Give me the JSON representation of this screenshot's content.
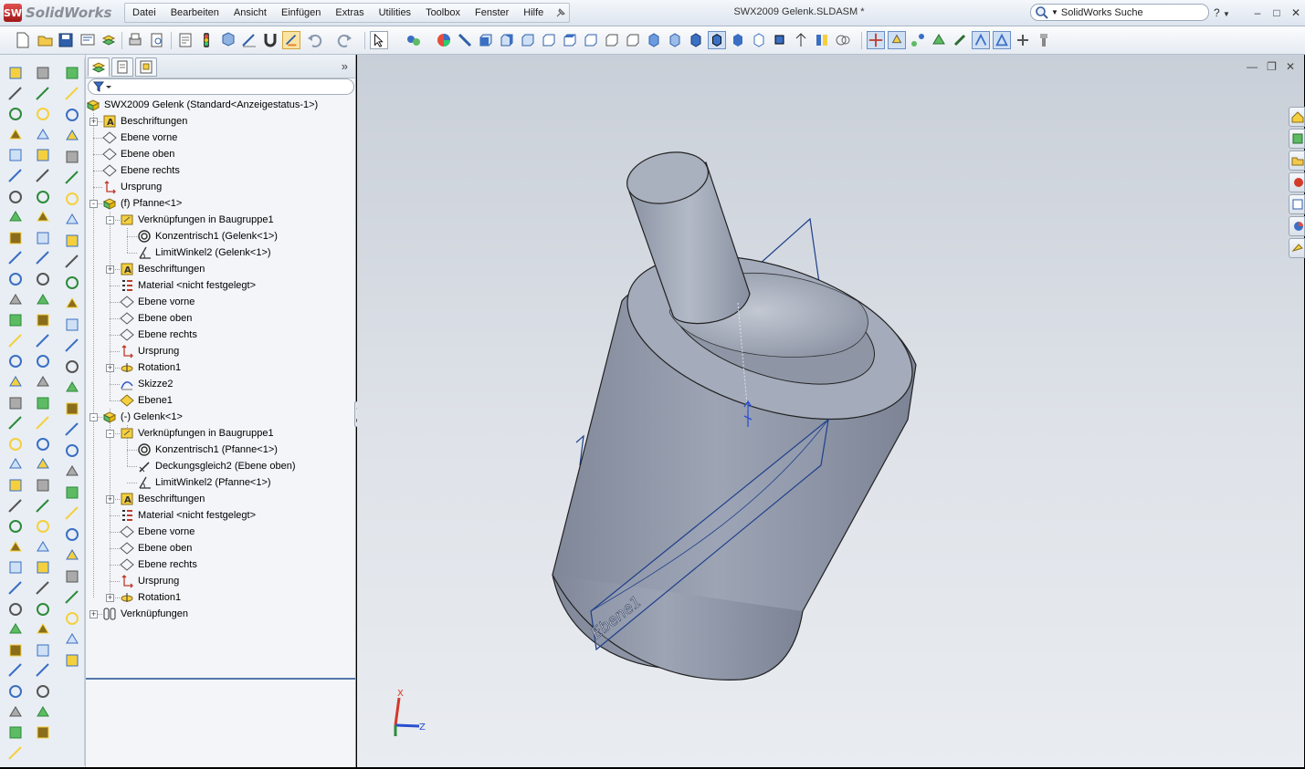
{
  "app": {
    "logo_text": "SolidWorks",
    "document_title": "SWX2009 Gelenk.SLDASM *",
    "search_placeholder": "SolidWorks Suche",
    "help_label": "?",
    "menus": [
      "Datei",
      "Bearbeiten",
      "Ansicht",
      "Einfügen",
      "Extras",
      "Utilities",
      "Toolbox",
      "Fenster",
      "Hilfe"
    ]
  },
  "feature_tree": {
    "root": "SWX2009 Gelenk  (Standard<Anzeigestatus-1>)",
    "items": [
      {
        "label": "Beschriftungen",
        "icon": "annotations-icon",
        "level": 0,
        "expander": "+"
      },
      {
        "label": "Ebene vorne",
        "icon": "plane-icon",
        "level": 0
      },
      {
        "label": "Ebene oben",
        "icon": "plane-icon",
        "level": 0
      },
      {
        "label": "Ebene rechts",
        "icon": "plane-icon",
        "level": 0
      },
      {
        "label": "Ursprung",
        "icon": "origin-icon",
        "level": 0
      },
      {
        "label": "(f) Pfanne<1>",
        "icon": "part-icon",
        "level": 0,
        "expander": "-"
      },
      {
        "label": "Verknüpfungen in Baugruppe1",
        "icon": "mates-folder-icon",
        "level": 1,
        "expander": "-"
      },
      {
        "label": "Konzentrisch1 (Gelenk<1>)",
        "icon": "concentric-mate-icon",
        "level": 2
      },
      {
        "label": "LimitWinkel2 (Gelenk<1>)",
        "icon": "limit-angle-mate-icon",
        "level": 2
      },
      {
        "label": "Beschriftungen",
        "icon": "annotations-icon",
        "level": 1,
        "expander": "+"
      },
      {
        "label": "Material <nicht festgelegt>",
        "icon": "material-icon",
        "level": 1
      },
      {
        "label": "Ebene vorne",
        "icon": "plane-icon",
        "level": 1
      },
      {
        "label": "Ebene oben",
        "icon": "plane-icon",
        "level": 1
      },
      {
        "label": "Ebene rechts",
        "icon": "plane-icon",
        "level": 1
      },
      {
        "label": "Ursprung",
        "icon": "origin-icon",
        "level": 1
      },
      {
        "label": "Rotation1",
        "icon": "revolve-icon",
        "level": 1,
        "expander": "+"
      },
      {
        "label": "Skizze2",
        "icon": "sketch-icon",
        "level": 1
      },
      {
        "label": "Ebene1",
        "icon": "plane-feature-icon",
        "level": 1
      },
      {
        "label": "(-) Gelenk<1>",
        "icon": "part-icon",
        "level": 0,
        "expander": "-"
      },
      {
        "label": "Verknüpfungen in Baugruppe1",
        "icon": "mates-folder-icon",
        "level": 1,
        "expander": "-"
      },
      {
        "label": "Konzentrisch1 (Pfanne<1>)",
        "icon": "concentric-mate-icon",
        "level": 2
      },
      {
        "label": "Deckungsgleich2 (Ebene oben)",
        "icon": "coincident-mate-icon",
        "level": 2
      },
      {
        "label": "LimitWinkel2 (Pfanne<1>)",
        "icon": "limit-angle-mate-icon",
        "level": 2
      },
      {
        "label": "Beschriftungen",
        "icon": "annotations-icon",
        "level": 1,
        "expander": "+"
      },
      {
        "label": "Material <nicht festgelegt>",
        "icon": "material-icon",
        "level": 1
      },
      {
        "label": "Ebene vorne",
        "icon": "plane-icon",
        "level": 1
      },
      {
        "label": "Ebene oben",
        "icon": "plane-icon",
        "level": 1
      },
      {
        "label": "Ebene rechts",
        "icon": "plane-icon",
        "level": 1
      },
      {
        "label": "Ursprung",
        "icon": "origin-icon",
        "level": 1
      },
      {
        "label": "Rotation1",
        "icon": "revolve-icon",
        "level": 1,
        "expander": "+"
      },
      {
        "label": "Verknüpfungen",
        "icon": "mates-icon",
        "level": -1,
        "expander": "+"
      }
    ]
  },
  "viewport": {
    "plane_label": "Ebene1",
    "triad": {
      "x": "X",
      "z": "Z"
    },
    "model_color": "#8e96a6",
    "plane_color": "#1f3f8a"
  },
  "colors": {
    "accent": "#3a6fc4",
    "titlebar": "#dde5ef"
  }
}
